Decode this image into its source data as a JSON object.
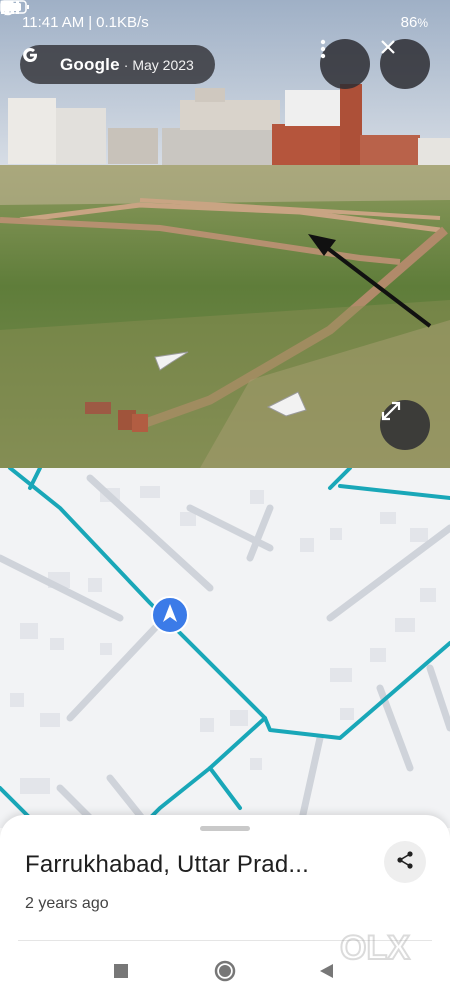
{
  "status_bar": {
    "time": "11:41 AM",
    "network_speed": "0.1KB/s",
    "battery": "86",
    "battery_unit": "%"
  },
  "street_view": {
    "source_brand": "Google",
    "capture_date": "· May 2023"
  },
  "icons": {
    "google": "google-g-icon",
    "more": "more-vert-icon",
    "close": "close-icon",
    "expand": "expand-icon",
    "share": "share-icon",
    "location": "navigation-arrow-icon"
  },
  "place": {
    "name": "Farrukhabad, Uttar Prad...",
    "time_ago": "2 years ago"
  },
  "watermark": {
    "text": "OLX"
  },
  "colors": {
    "route": "#19a7b8",
    "marker": "#3b7be8",
    "map_bg": "#f2f3f5",
    "map_roads": "#cfd3da",
    "chip_bg": "#323237"
  }
}
